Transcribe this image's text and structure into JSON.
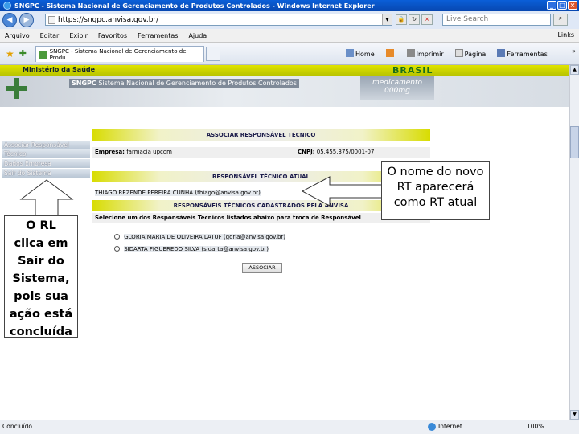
{
  "window": {
    "title": "SNGPC - Sistema Nacional de Gerenciamento de Produtos Controlados - Windows Internet Explorer"
  },
  "address": {
    "url": "https://sngpc.anvisa.gov.br/",
    "search_placeholder": "Live Search"
  },
  "menu": {
    "items": [
      "Arquivo",
      "Editar",
      "Exibir",
      "Favoritos",
      "Ferramentas",
      "Ajuda"
    ],
    "links": "Links"
  },
  "toolbar": {
    "tab_title": "SNGPC - Sistema Nacional de Gerenciamento de Produ...",
    "home": "Home",
    "print": "Imprimir",
    "page": "Página",
    "tools": "Ferramentas",
    "more": "»"
  },
  "banner": {
    "ministerio": "Ministério da Saúde",
    "brasil": "BRASIL",
    "sngpc_bold": "SNGPC",
    "sngpc_text": "Sistema Nacional de Gerenciamento de Produtos Controlados",
    "med_line1": "medicamento",
    "med_line2": "000mg"
  },
  "sidebar": {
    "items": [
      "Associar Responsável",
      "Técnico",
      "Dados Empresa",
      "Sair do Sistema"
    ]
  },
  "form": {
    "header_associar": "ASSOCIAR RESPONSÁVEL TÉCNICO",
    "empresa_label": "Empresa:",
    "empresa_value": "farmacia upcom",
    "cnpj_label": "CNPJ:",
    "cnpj_value": "05.455.375/0001-07",
    "header_atual": "RESPONSÁVEL TÉCNICO ATUAL",
    "atual_name": "THIAGO REZENDE PEREIRA CUNHA",
    "atual_email": "(thiago@anvisa.gov.br)",
    "header_cadastrados": "RESPONSÁVEIS TÉCNICOS CADASTRADOS PELA ANVISA",
    "instruction": "Selecione um dos Responsáveis Técnicos listados abaixo para troca de Responsável",
    "options": [
      {
        "name": "GLORIA MARIA DE OLIVEIRA LATUF",
        "email": "(gorla@anvisa.gov.br)"
      },
      {
        "name": "SIDARTA FIGUEREDO SILVA",
        "email": "(sidarta@anvisa.gov.br)"
      }
    ],
    "associar_button": "ASSOCIAR"
  },
  "callouts": {
    "right": [
      "O nome do novo",
      "RT aparecerá",
      "como RT atual"
    ],
    "left": [
      "O RL",
      "clica em",
      "Sair do",
      "Sistema,",
      "pois sua",
      "ação está",
      "concluída"
    ]
  },
  "status": {
    "done": "Concluído",
    "zone": "Internet",
    "zoom": "100%"
  }
}
